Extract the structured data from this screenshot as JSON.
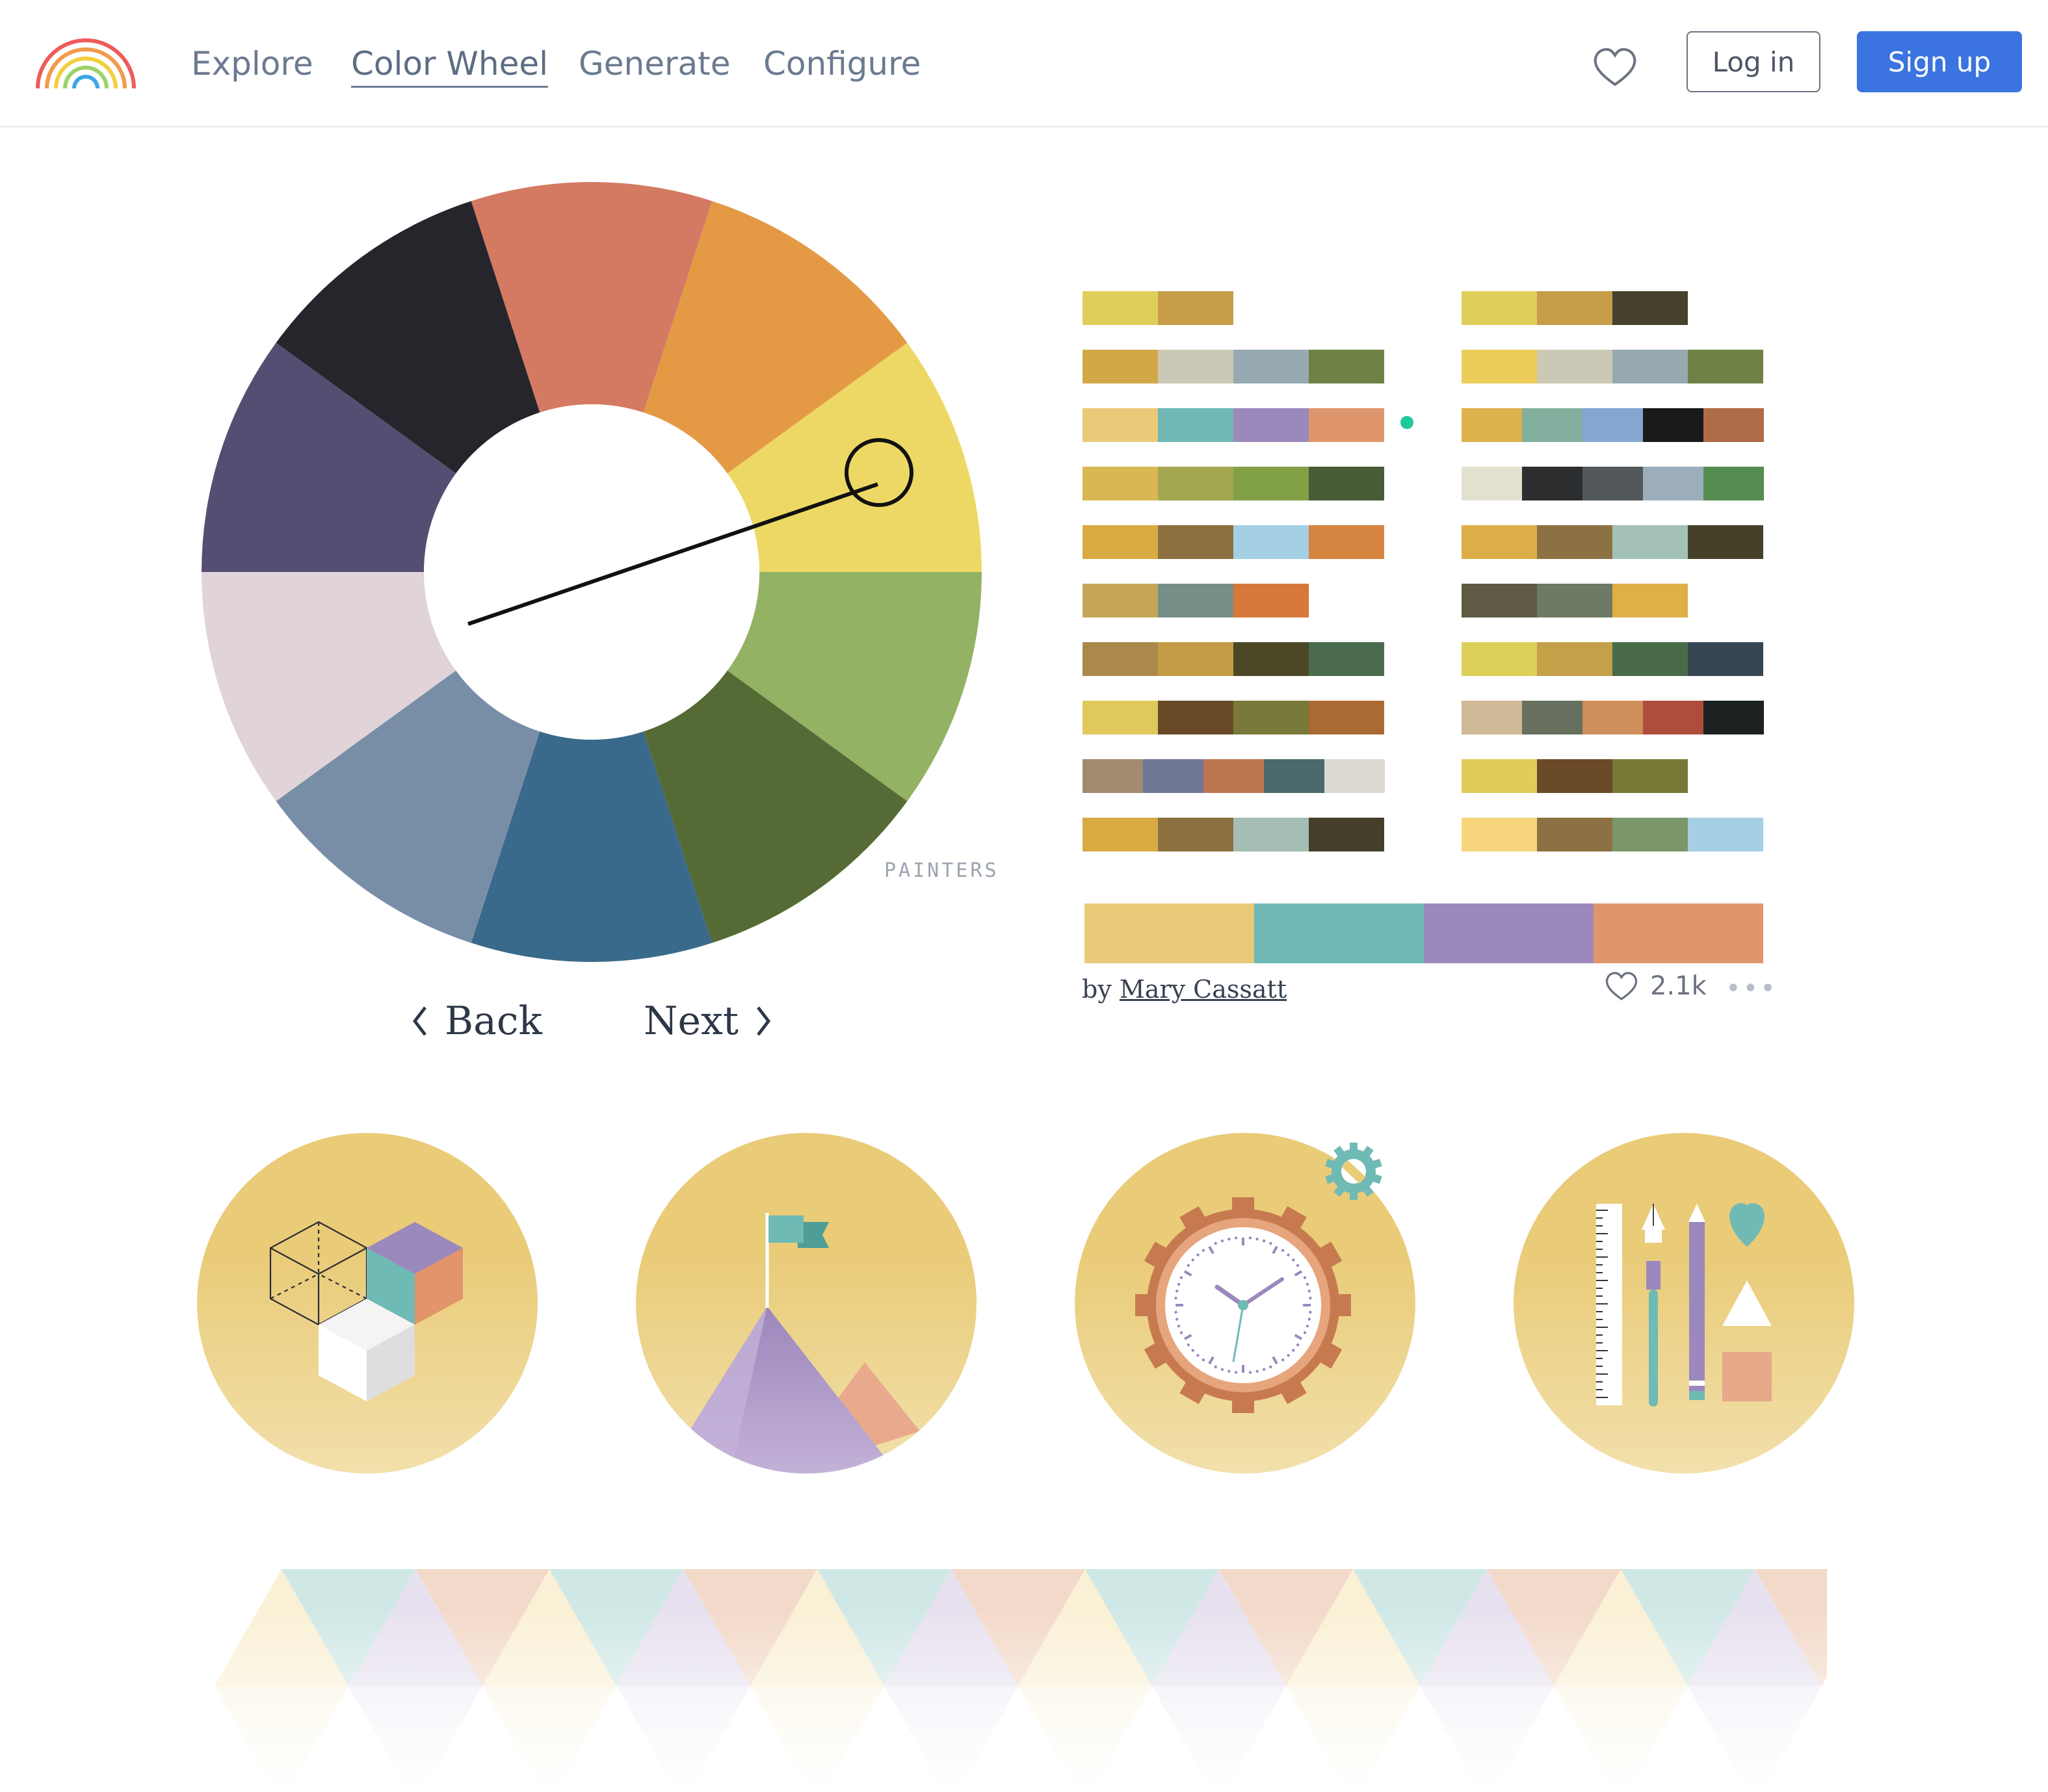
{
  "nav": {
    "links": [
      "Explore",
      "Color Wheel",
      "Generate",
      "Configure"
    ],
    "login": "Log in",
    "signup": "Sign up"
  },
  "wheel": {
    "label": "PAINTERS",
    "segments": [
      "#d47a62",
      "#e49a45",
      "#eed865",
      "#93b264",
      "#556a35",
      "#3a6a8b",
      "#788ea7",
      "#e0d4d8",
      "#544f72",
      "#26252b"
    ],
    "back": "Back",
    "next": "Next"
  },
  "palettes": {
    "left": [
      [
        "#dfcf5a",
        "#c79d4a"
      ],
      [
        "#d2a847",
        "#cbc9b5",
        "#97aab2",
        "#6f8145"
      ],
      [
        "#e8ca78",
        "#6fb8b5",
        "#9c89bb",
        "#e0966c"
      ],
      [
        "#d9b752",
        "#a4a752",
        "#82a045",
        "#485c37"
      ],
      [
        "#d9aa42",
        "#8d7040",
        "#a4cfe5",
        "#d68540"
      ],
      [
        "#c6a75a",
        "#768f89",
        "#d5783a"
      ],
      [
        "#aa894b",
        "#c39c45",
        "#4c4825",
        "#4b6b4e"
      ],
      [
        "#e0c95a",
        "#684a27",
        "#797939",
        "#aa6a31"
      ],
      [
        "#a28b6f",
        "#6e7895",
        "#be7650",
        "#4a6a6b",
        "#dddad2"
      ],
      [
        "#d9aa42",
        "#8d7040",
        "#a4beb4",
        "#453f29"
      ]
    ],
    "right": [
      [
        "#dfcf5a",
        "#c79d4a",
        "#46412b"
      ],
      [
        "#edcd59",
        "#cbc9b5",
        "#97aab2",
        "#6f8145"
      ],
      [
        "#ddb24d",
        "#83b09e",
        "#84a6d0",
        "#181a1c",
        "#b06c48"
      ],
      [
        "#e2e1cf",
        "#2c2d2f",
        "#52585a",
        "#9cadbb",
        "#558c50"
      ],
      [
        "#ddae47",
        "#8c7143",
        "#a3c1b6",
        "#474029"
      ],
      [
        "#605a45",
        "#6d7a65",
        "#deb046"
      ],
      [
        "#ddd05a",
        "#c4a049",
        "#486a48",
        "#374550"
      ],
      [
        "#cfb996",
        "#67705e",
        "#cf8e5a",
        "#ae4d3e",
        "#1c2221"
      ],
      [
        "#e1cc59",
        "#6b4a28",
        "#787935"
      ],
      [
        "#f6d57d",
        "#8d7142",
        "#7b9769",
        "#a4cfe5"
      ]
    ],
    "featured": [
      "#e8ca78",
      "#6fb8b5",
      "#9c89bb",
      "#e0966c"
    ],
    "author_prefix": "by",
    "author": "Mary Cassatt",
    "likes": "2.1k",
    "more": "•••"
  },
  "features": [
    "cube-illustration",
    "mountain-flag-illustration",
    "clock-gear-illustration",
    "tools-illustration"
  ],
  "colors": {
    "accent": "#3b74e0",
    "feature_bg_top": "#e9cb78",
    "feature_bg_bottom": "#f2e0ab"
  }
}
